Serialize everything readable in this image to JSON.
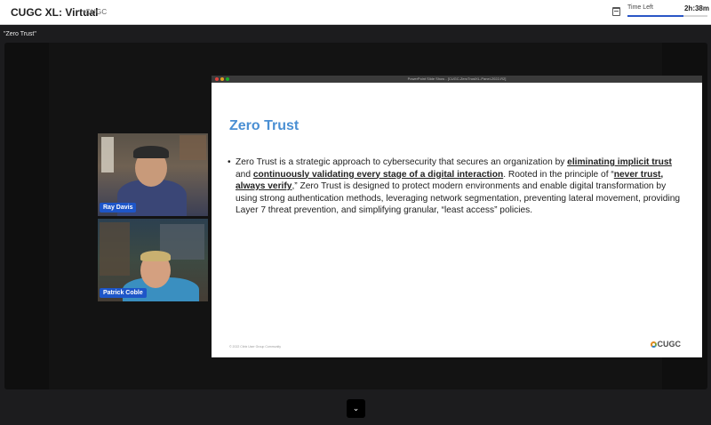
{
  "header": {
    "app_title": "CUGC XL: Virtual",
    "org": "CUGC",
    "calendar_icon": "calendar-icon",
    "time_left_label": "Time Left",
    "time_left_value": "2h:38m",
    "time_progress": 0.7
  },
  "session": {
    "label": "\"Zero Trust\""
  },
  "participants": [
    {
      "name": "Ray Davis"
    },
    {
      "name": "Patrick Coble"
    }
  ],
  "slide": {
    "window_title": "PowerPoint Slide Show - [CUGC-ZeroTrustXL-Panel-2022-R2]",
    "heading": "Zero Trust",
    "bullet_char": "•",
    "body": {
      "t1": "Zero Trust is a strategic approach to cybersecurity that secures an organization by ",
      "u1": "eliminating implicit trust",
      "t2": " and ",
      "u2": "continuously validating every stage of a digital interaction",
      "t3": ". Rooted in the principle of “",
      "u3": "never trust, always verify",
      "t4": ",” Zero Trust is designed to protect modern environments and enable digital transformation by using strong authentication methods, leveraging network segmentation, preventing lateral movement, providing Layer 7 threat prevention, and simplifying granular, “least access” policies."
    },
    "footer": "© 2022 Citrix User Group Community",
    "logo_text": "CUGC"
  },
  "controls": {
    "expand_glyph": "⌄",
    "expand_icon": "chevron-down-icon"
  },
  "colors": {
    "accent": "#2a56c6",
    "slide_heading": "#4a8fd3",
    "name_tag": "#1e56c8"
  }
}
